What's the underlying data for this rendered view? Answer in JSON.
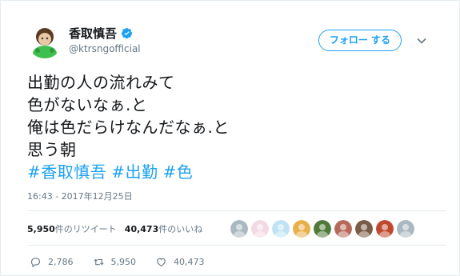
{
  "user": {
    "display_name": "香取慎吾",
    "handle": "@ktrsngofficial"
  },
  "follow_button": {
    "label": "フォロー する"
  },
  "tweet": {
    "lines": [
      "出勤の人の流れみて",
      "色がないなぁ.と",
      "俺は色だらけなんだなぁ.と",
      "思う朝"
    ],
    "hashtags": [
      "#香取慎吾",
      "#出勤",
      "#色"
    ],
    "timestamp": "16:43 - 2017年12月25日"
  },
  "stats": {
    "retweets_count": "5,950",
    "retweets_label": "件のリツイート",
    "likes_count": "40,473",
    "likes_label": "件のいいね"
  },
  "actions": {
    "reply_count": "2,786",
    "retweet_count": "5,950",
    "like_count": "40,473"
  },
  "likers": [
    {
      "icon": "default-avatar",
      "color": "#aab8c2"
    },
    {
      "icon": "flower-avatar",
      "color": "#f3d9e4"
    },
    {
      "icon": "egg-avatar",
      "color": "#bfe3f5"
    },
    {
      "icon": "character-avatar",
      "color": "#e8b04a"
    },
    {
      "icon": "green-avatar",
      "color": "#4f7a3a"
    },
    {
      "icon": "photo-avatar",
      "color": "#b86a5a"
    },
    {
      "icon": "person-avatar",
      "color": "#7a5c46"
    },
    {
      "icon": "red-avatar",
      "color": "#c0482e"
    },
    {
      "icon": "default-avatar",
      "color": "#aab8c2"
    }
  ],
  "colors": {
    "accent": "#1da1f2",
    "text": "#14171a",
    "muted": "#657786",
    "verified": "#1da1f2"
  }
}
